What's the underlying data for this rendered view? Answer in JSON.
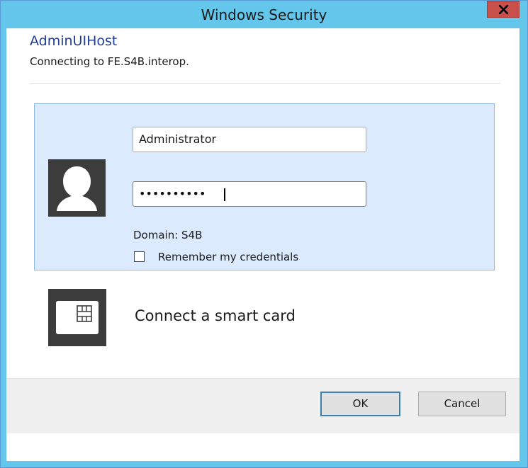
{
  "window": {
    "title": "Windows Security",
    "close_label": "x"
  },
  "header": {
    "app_name": "AdminUIHost",
    "subtitle": "Connecting to FE.S4B.interop."
  },
  "credentials": {
    "username_value": "Administrator",
    "password_mask": "••••••••••",
    "domain_label": "Domain: S4B",
    "remember_label": "Remember my credentials",
    "remember_checked": false
  },
  "smart_card": {
    "label": "Connect a smart card"
  },
  "footer": {
    "ok_label": "OK",
    "cancel_label": "Cancel"
  },
  "colors": {
    "titlebar": "#63c6ea",
    "close": "#c9504a",
    "tile_background": "#dbeafd",
    "accent_text": "#1f3d99"
  }
}
